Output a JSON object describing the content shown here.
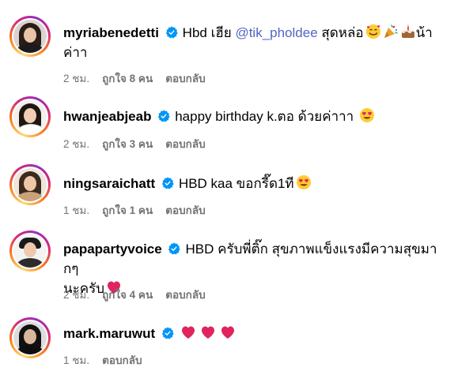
{
  "comments": [
    {
      "username": "myriabenedetti",
      "text_before": "Hbd เฮีย ",
      "mention": "@tik_pholdee",
      "text_after": " สุดหล่อ",
      "text_line2": "ค่าา",
      "time": "2 ชม.",
      "likes": "ถูกใจ 8 คน",
      "reply": "ตอบกลับ",
      "trailing_text": "น้า",
      "emojis": [
        "smiling-face-with-hearts",
        "party-popper",
        "birthday-cake"
      ]
    },
    {
      "username": "hwanjeabjeab",
      "text": "happy birthday k.ตอ ด้วยค่าาา ",
      "time": "2 ชม.",
      "likes": "ถูกใจ 3 คน",
      "reply": "ตอบกลับ",
      "emojis": [
        "heart-eyes"
      ]
    },
    {
      "username": "ningsaraichatt",
      "text": "HBD kaa ขอกรี๊ด1ที",
      "time": "1 ชม.",
      "likes": "ถูกใจ 1 คน",
      "reply": "ตอบกลับ",
      "emojis": [
        "heart-eyes"
      ]
    },
    {
      "username": "papapartyvoice",
      "text": "HBD ครับพี่ติ๊ก สุขภาพแข็งแรงมีความสุขมากๆ",
      "text_line2": "นะครับ",
      "time": "2 ชม.",
      "likes": "ถูกใจ 4 คน",
      "reply": "ตอบกลับ",
      "emojis": [
        "red-heart"
      ]
    },
    {
      "username": "mark.maruwut",
      "text": "",
      "time": "1 ชม.",
      "reply": "ตอบกลับ",
      "emojis": [
        "red-heart",
        "red-heart",
        "red-heart"
      ]
    }
  ],
  "colors": {
    "verified": "#0095f6",
    "mention": "#4f67c4",
    "meta": "#737373",
    "heart": "#e0245e"
  }
}
